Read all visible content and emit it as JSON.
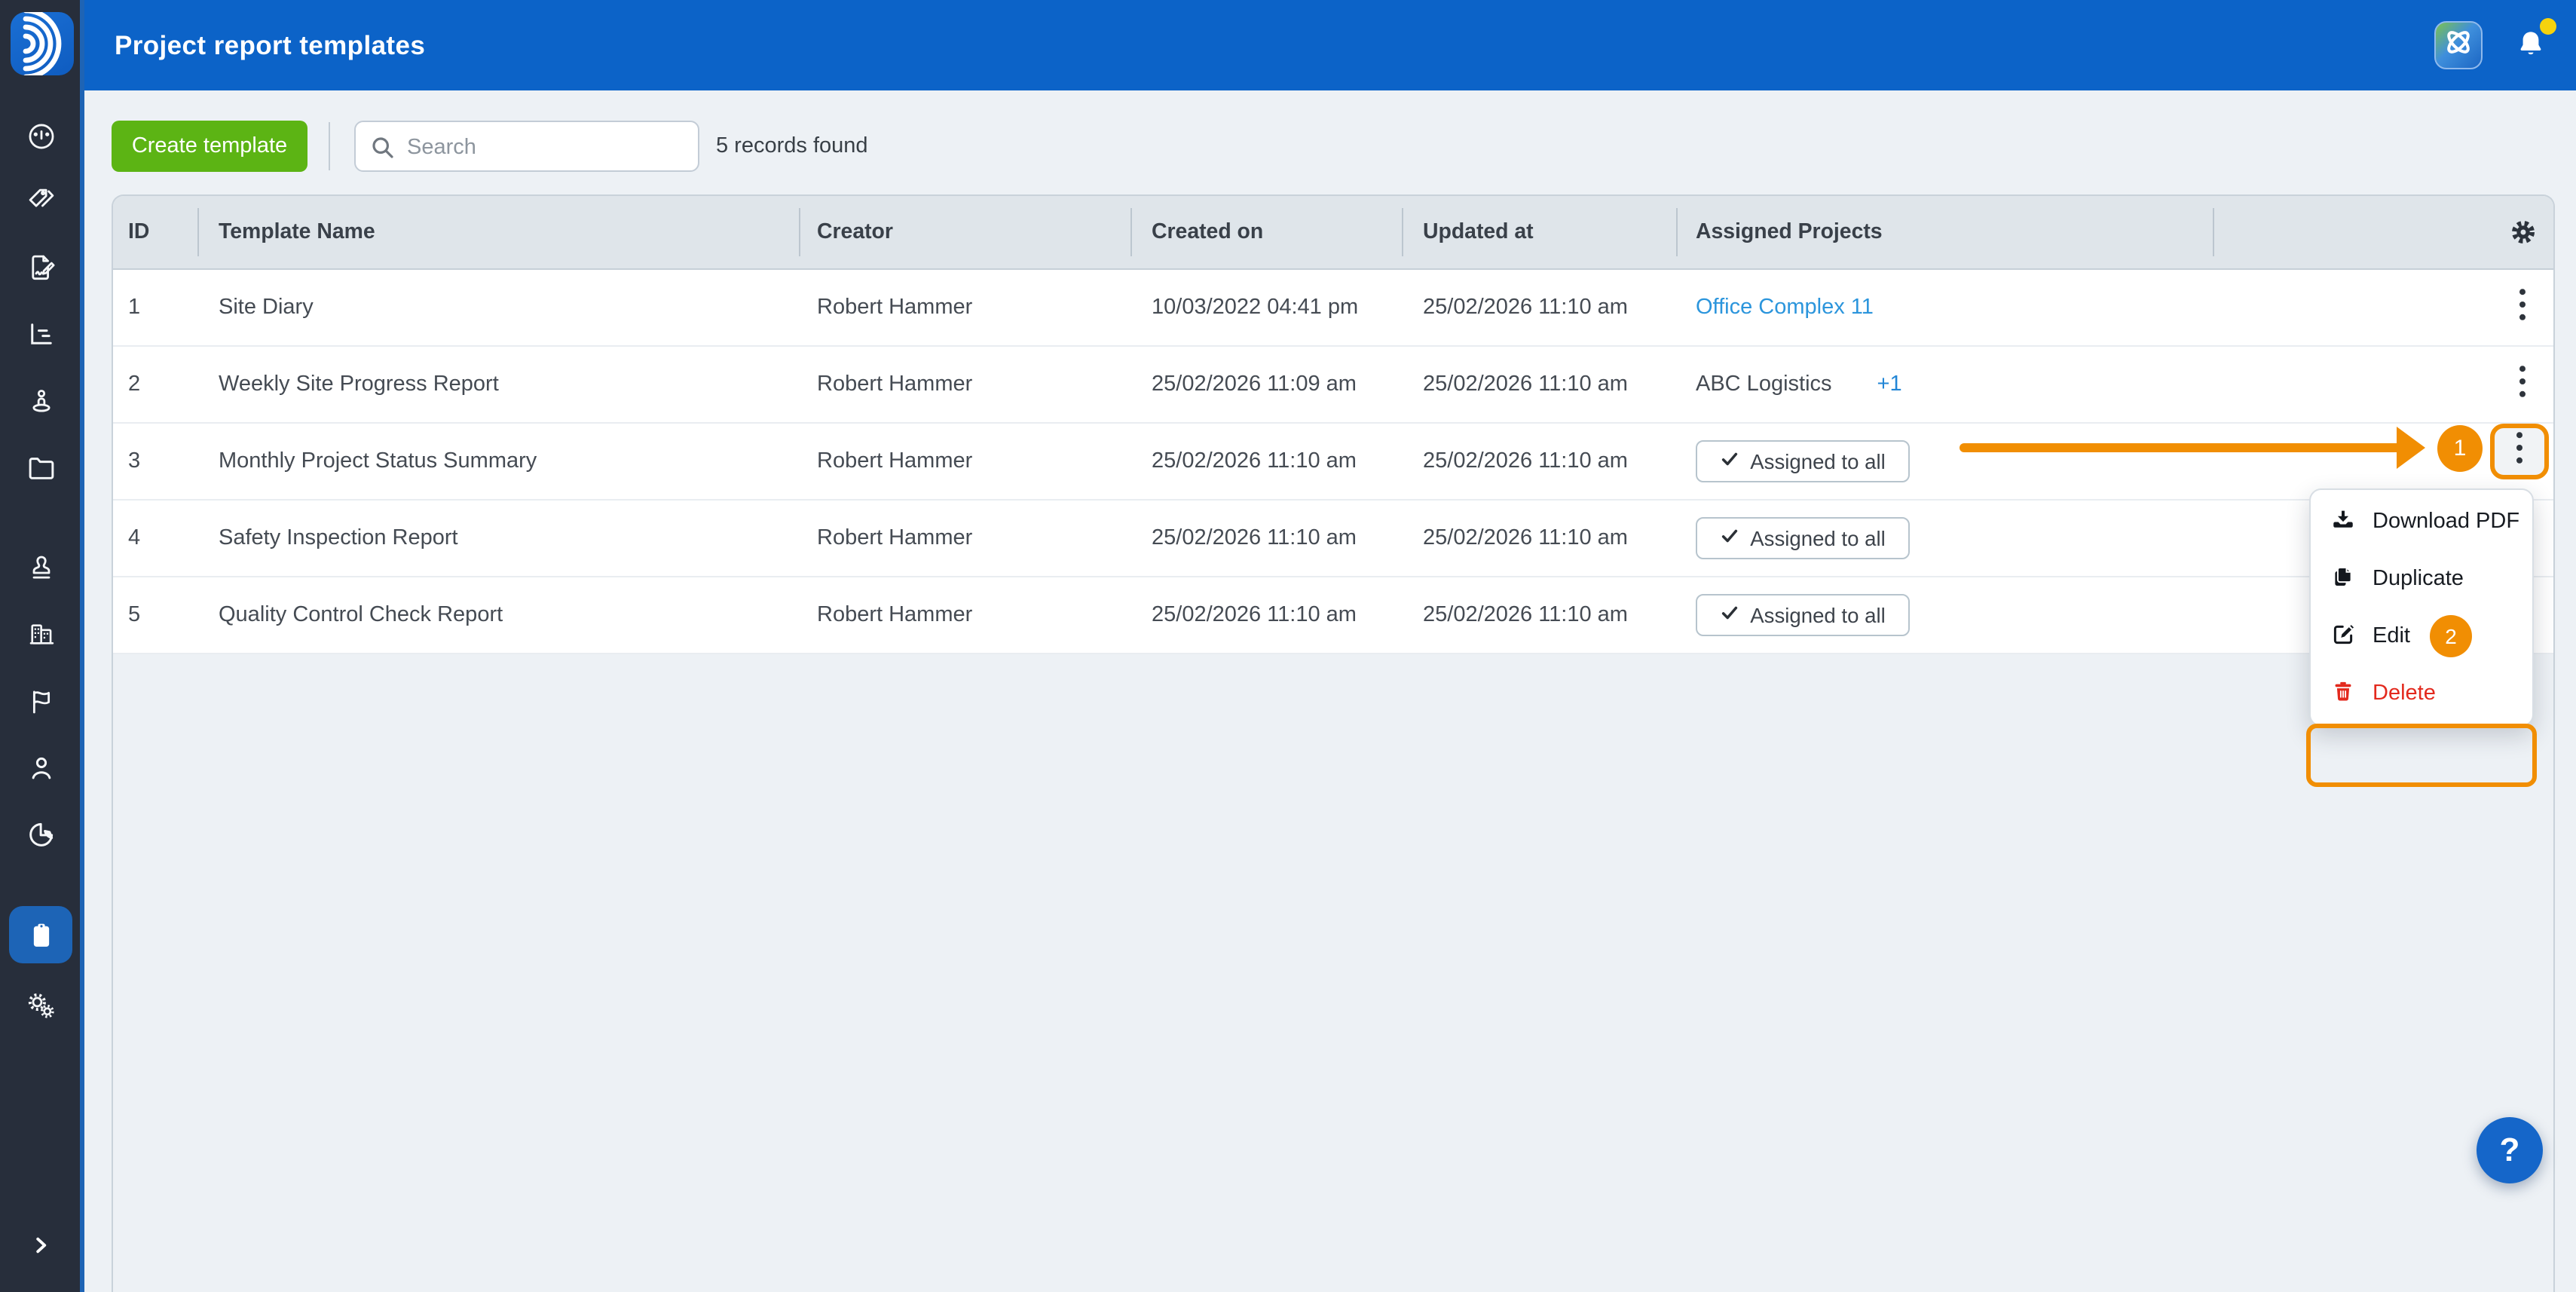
{
  "topbar": {
    "title": "Project report templates"
  },
  "toolbar": {
    "create_label": "Create template",
    "search_placeholder": "Search",
    "records_text": "5 records found"
  },
  "table": {
    "columns": {
      "id": "ID",
      "name": "Template Name",
      "creator": "Creator",
      "created": "Created on",
      "updated": "Updated at",
      "assigned": "Assigned Projects"
    },
    "rows": [
      {
        "id": "1",
        "name": "Site Diary",
        "creator": "Robert Hammer",
        "created": "10/03/2022 04:41 pm",
        "updated": "25/02/2026 11:10 am",
        "assigned_link": "Office Complex 11"
      },
      {
        "id": "2",
        "name": "Weekly Site Progress Report",
        "creator": "Robert Hammer",
        "created": "25/02/2026 11:09 am",
        "updated": "25/02/2026 11:10 am",
        "assigned_text": "ABC Logistics",
        "assigned_more": "+1"
      },
      {
        "id": "3",
        "name": "Monthly Project Status Summary",
        "creator": "Robert Hammer",
        "created": "25/02/2026 11:10 am",
        "updated": "25/02/2026 11:10 am",
        "assigned_button": "Assigned to all"
      },
      {
        "id": "4",
        "name": "Safety Inspection Report",
        "creator": "Robert Hammer",
        "created": "25/02/2026 11:10 am",
        "updated": "25/02/2026 11:10 am",
        "assigned_button": "Assigned to all"
      },
      {
        "id": "5",
        "name": "Quality Control Check Report",
        "creator": "Robert Hammer",
        "created": "25/02/2026 11:10 am",
        "updated": "25/02/2026 11:10 am",
        "assigned_button": "Assigned to all"
      }
    ]
  },
  "context_menu": {
    "download": "Download PDF",
    "duplicate": "Duplicate",
    "edit": "Edit",
    "delete": "Delete"
  },
  "annotations": {
    "step1": "1",
    "step2": "2"
  },
  "help": {
    "label": "?"
  },
  "sidebar": {
    "items": [
      {
        "icon": "dashboard-icon",
        "active": false
      },
      {
        "icon": "tags-icon",
        "active": false
      },
      {
        "icon": "document-edit-icon",
        "active": false
      },
      {
        "icon": "chart-icon",
        "active": false
      },
      {
        "icon": "person-pin-icon",
        "active": false
      },
      {
        "icon": "folder-icon",
        "active": false
      },
      {
        "icon": "stamp-icon",
        "active": false
      },
      {
        "icon": "buildings-icon",
        "active": false
      },
      {
        "icon": "flag-icon",
        "active": false
      },
      {
        "icon": "user-icon",
        "active": false
      },
      {
        "icon": "pie-chart-icon",
        "active": false
      },
      {
        "icon": "clipboard-icon",
        "active": true
      },
      {
        "icon": "gears-icon",
        "active": false
      }
    ]
  },
  "colors": {
    "header_blue": "#0c63c8",
    "sidebar_dark": "#272e3b",
    "selected_blue": "#1d64b6",
    "green": "#5cb414",
    "orange": "#f18e03",
    "red": "#e3291d",
    "link_blue": "#2b95dc",
    "yellow_dot": "#f6d30d",
    "page_bg": "#edf1f5"
  }
}
